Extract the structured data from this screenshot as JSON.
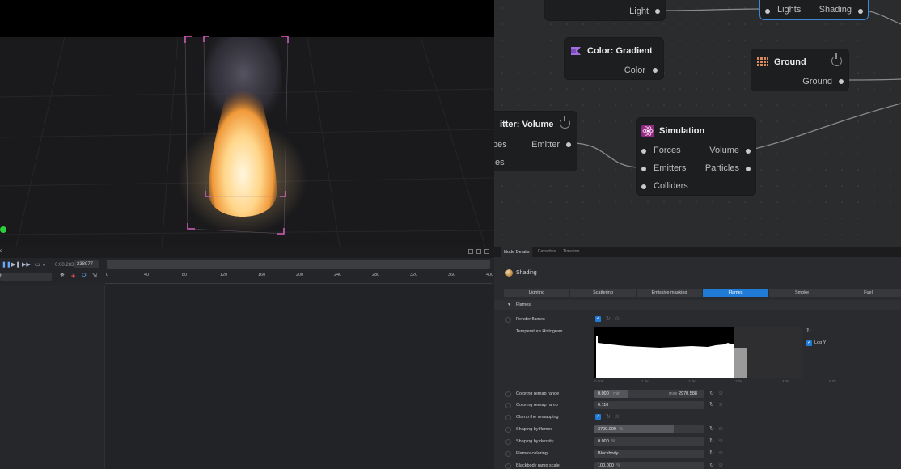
{
  "viewport": {
    "bg_color": "#1a1a1c",
    "selection_color": "#e05cc7"
  },
  "node_editor": {
    "nodes": {
      "lights_output": {
        "port": "Light"
      },
      "render": {
        "in_port": "Lights",
        "out_port": "Shading"
      },
      "color_gradient": {
        "title": "Color: Gradient",
        "port": "Color"
      },
      "ground": {
        "title": "Ground",
        "port": "Ground"
      },
      "emitter_volume": {
        "title": "itter: Volume",
        "in_port_1": "pes",
        "in_port_2": "es",
        "out_port": "Emitter"
      },
      "simulation": {
        "title": "Simulation",
        "in_forces": "Forces",
        "in_emitters": "Emitters",
        "in_colliders": "Colliders",
        "out_volume": "Volume",
        "out_particles": "Particles"
      }
    }
  },
  "timeline": {
    "panel_label": "e",
    "time_current": "0:00.283",
    "frame_value": "238977",
    "search_label": "h",
    "ruler_ticks": [
      "0",
      "40",
      "80",
      "120",
      "160",
      "200",
      "240",
      "280",
      "320",
      "360",
      "400"
    ]
  },
  "details": {
    "tabs": [
      "Node Details",
      "Favorites",
      "Timeline"
    ],
    "active_tab": "Node Details",
    "node_name": "Shading",
    "subtabs": [
      "Lighting",
      "Scattering",
      "Emissive masking",
      "Flames",
      "Smoke",
      "Fuel"
    ],
    "active_subtab": "Flames",
    "section": "Flames",
    "render_flames_label": "Render flames",
    "render_flames_checked": true,
    "histogram_label": "Temperature Histogram",
    "histogram_axis": [
      "0.00K",
      "1.0K",
      "2.0K",
      "3.0K",
      "4.0K",
      "5.0K"
    ],
    "log_y_label": "Log Y",
    "log_y_checked": true,
    "remap_range_label": "Coloring remap range",
    "remap_min": "0.000",
    "remap_min_unit": "min",
    "remap_max_unit": "max",
    "remap_max": "2970.588",
    "remap_ramp_label": "Coloring remap ramp",
    "remap_ramp_value": "0.110",
    "clamp_label": "Clamp the remapping",
    "clamp_checked": true,
    "shaping_flames_label": "Shaping by flames",
    "shaping_flames_value": "3700.000",
    "shaping_flames_fill": 0.72,
    "shaping_density_label": "Shaping by density",
    "shaping_density_value": "0.000",
    "flames_coloring_label": "Flames coloring",
    "flames_coloring_value": "Blackbody",
    "blackbody_scale_label": "Blackbody ramp scale",
    "blackbody_scale_value": "100.000",
    "percent_unit": "%",
    "accent_color": "#1f7bd6"
  }
}
